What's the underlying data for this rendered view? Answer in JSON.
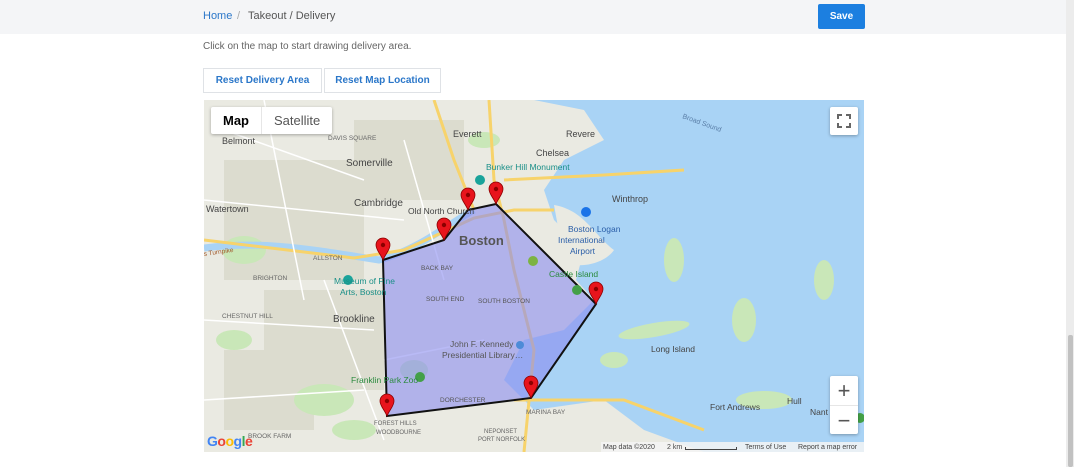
{
  "breadcrumb": {
    "home": "Home",
    "separator": "/",
    "current": "Takeout / Delivery"
  },
  "header": {
    "save_label": "Save"
  },
  "instructions": "Click on the map to start drawing delivery area.",
  "actions": {
    "reset_area": "Reset Delivery Area",
    "reset_location": "Reset Map Location"
  },
  "map": {
    "map_type": {
      "map": "Map",
      "satellite": "Satellite"
    },
    "zoom_in": "+",
    "zoom_out": "−",
    "google_letters": [
      "G",
      "o",
      "o",
      "g",
      "l",
      "e"
    ],
    "attribution": {
      "data": "Map data ©2020",
      "scale": "2 km",
      "terms": "Terms of Use",
      "report": "Report a map error"
    },
    "labels": {
      "everett": "Everett",
      "revere": "Revere",
      "broad_sound": "Broad Sound",
      "belmont": "Belmont",
      "davis_square": "DAVIS SQUARE",
      "somerville": "Somerville",
      "chelsea": "Chelsea",
      "bunker_hill": "Bunker Hill Monument",
      "winthrop": "Winthrop",
      "cambridge": "Cambridge",
      "watertown": "Watertown",
      "old_north": "Old North Church",
      "boston": "Boston",
      "logan": "Boston Logan",
      "logan2": "International",
      "logan3": "Airport",
      "allston": "ALLSTON",
      "back_bay": "BACK BAY",
      "castle_island": "Castle Island",
      "brighton": "BRIGHTON",
      "museum": "Museum of Fine",
      "museum2": "Arts, Boston",
      "south_end": "SOUTH END",
      "south_boston": "SOUTH BOSTON",
      "chestnut_hill": "CHESTNUT HILL",
      "brookline": "Brookline",
      "jfk": "John F. Kennedy",
      "jfk2": "Presidential Library…",
      "long_island": "Long Island",
      "franklin_zoo": "Franklin Park Zoo",
      "dorchester": "DORCHESTER",
      "marina_bay": "MARINA BAY",
      "fort_andrews": "Fort Andrews",
      "hull": "Hull",
      "forest_hills": "FOREST HILLS",
      "woodbourne": "WOODBOURNE",
      "brook_farm": "BROOK FARM",
      "neponset": "NEPONSET",
      "port_norfolk": "PORT NORFOLK",
      "turnpike": "s Turnpike",
      "nant": "Nant"
    }
  },
  "colors": {
    "accent": "#1c7fe0",
    "link": "#2b77c9",
    "water": "#a9d3f5",
    "polygon_fill": "#8a8cf0",
    "marker": "#e8141c"
  }
}
